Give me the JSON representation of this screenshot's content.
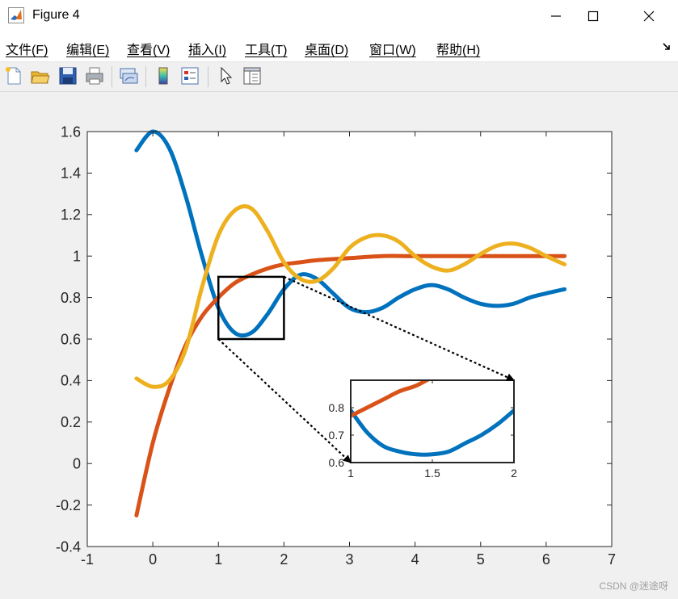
{
  "window": {
    "title": "Figure 4",
    "minimize_icon": "minimize-icon",
    "maximize_icon": "maximize-icon",
    "close_icon": "close-icon"
  },
  "menu": {
    "items": [
      "文件(F)",
      "编辑(E)",
      "查看(V)",
      "插入(I)",
      "工具(T)",
      "桌面(D)",
      "窗口(W)",
      "帮助(H)"
    ],
    "overflow_icon": "dock-arrow-icon"
  },
  "toolbar": {
    "icons": [
      "new-figure-icon",
      "open-icon",
      "save-icon",
      "print-icon",
      "link-plot-icon",
      "colorbar-icon",
      "legend-icon",
      "pointer-icon",
      "property-inspector-icon"
    ]
  },
  "watermark": "CSDN @迷途呀",
  "chart_data": [
    {
      "type": "line",
      "title": "",
      "xlabel": "",
      "ylabel": "",
      "xlim": [
        -1,
        7
      ],
      "ylim": [
        -0.4,
        1.6
      ],
      "xticks": [
        "-1",
        "0",
        "1",
        "2",
        "3",
        "4",
        "5",
        "6",
        "7"
      ],
      "yticks": [
        "-0.4",
        "-0.2",
        "0",
        "0.2",
        "0.4",
        "0.6",
        "0.8",
        "1",
        "1.2",
        "1.4",
        "1.6"
      ],
      "grid": false,
      "colors": [
        "#0072BD",
        "#D95319",
        "#EDB120"
      ],
      "series": [
        {
          "x": [
            -0.25,
            0,
            0.25,
            0.5,
            0.75,
            1,
            1.25,
            1.5,
            1.75,
            2,
            2.25,
            2.5,
            2.75,
            3,
            3.25,
            3.5,
            3.75,
            4,
            4.25,
            4.5,
            4.75,
            5,
            5.25,
            5.5,
            5.75,
            6,
            6.28
          ],
          "y": [
            1.51,
            1.6,
            1.52,
            1.29,
            1.0,
            0.75,
            0.63,
            0.63,
            0.72,
            0.84,
            0.91,
            0.89,
            0.82,
            0.75,
            0.73,
            0.75,
            0.8,
            0.84,
            0.86,
            0.84,
            0.8,
            0.77,
            0.76,
            0.77,
            0.8,
            0.82,
            0.84
          ]
        },
        {
          "x": [
            -0.25,
            0,
            0.25,
            0.5,
            0.75,
            1,
            1.25,
            1.5,
            1.75,
            2,
            2.25,
            2.5,
            3,
            3.5,
            4,
            5,
            6,
            6.28
          ],
          "y": [
            -0.25,
            0.1,
            0.36,
            0.57,
            0.71,
            0.8,
            0.87,
            0.91,
            0.94,
            0.96,
            0.97,
            0.98,
            0.99,
            1.0,
            1.0,
            1.0,
            1.0,
            1.0
          ]
        },
        {
          "x": [
            -0.25,
            0,
            0.25,
            0.5,
            0.75,
            1,
            1.25,
            1.5,
            1.75,
            2,
            2.25,
            2.5,
            2.75,
            3,
            3.25,
            3.5,
            3.75,
            4,
            4.25,
            4.5,
            4.75,
            5,
            5.25,
            5.5,
            5.75,
            6,
            6.28
          ],
          "y": [
            0.41,
            0.37,
            0.4,
            0.55,
            0.85,
            1.1,
            1.22,
            1.23,
            1.12,
            0.97,
            0.89,
            0.88,
            0.94,
            1.04,
            1.09,
            1.1,
            1.07,
            1.0,
            0.95,
            0.93,
            0.96,
            1.01,
            1.05,
            1.06,
            1.04,
            1.0,
            0.96
          ]
        }
      ],
      "zoom_box": {
        "xlim": [
          1,
          2
        ],
        "ylim": [
          0.6,
          0.9
        ]
      }
    },
    {
      "type": "line",
      "title": "",
      "xlabel": "",
      "ylabel": "",
      "xlim": [
        1,
        2
      ],
      "ylim": [
        0.6,
        0.9
      ],
      "xticks": [
        "1",
        "1.5",
        "2"
      ],
      "yticks": [
        "0.6",
        "0.7",
        "0.8"
      ],
      "grid": false,
      "colors": [
        "#0072BD",
        "#D95319"
      ],
      "series": [
        {
          "x": [
            1,
            1.1,
            1.2,
            1.3,
            1.4,
            1.5,
            1.6,
            1.7,
            1.8,
            1.9,
            2
          ],
          "y": [
            0.79,
            0.71,
            0.66,
            0.64,
            0.63,
            0.63,
            0.64,
            0.67,
            0.7,
            0.74,
            0.79
          ]
        },
        {
          "x": [
            1,
            1.1,
            1.2,
            1.3,
            1.4,
            1.5,
            1.6,
            1.7,
            1.8,
            1.9,
            2
          ],
          "y": [
            0.77,
            0.8,
            0.83,
            0.86,
            0.88,
            0.91,
            0.93,
            0.94,
            0.95,
            0.96,
            0.96
          ]
        }
      ]
    }
  ]
}
